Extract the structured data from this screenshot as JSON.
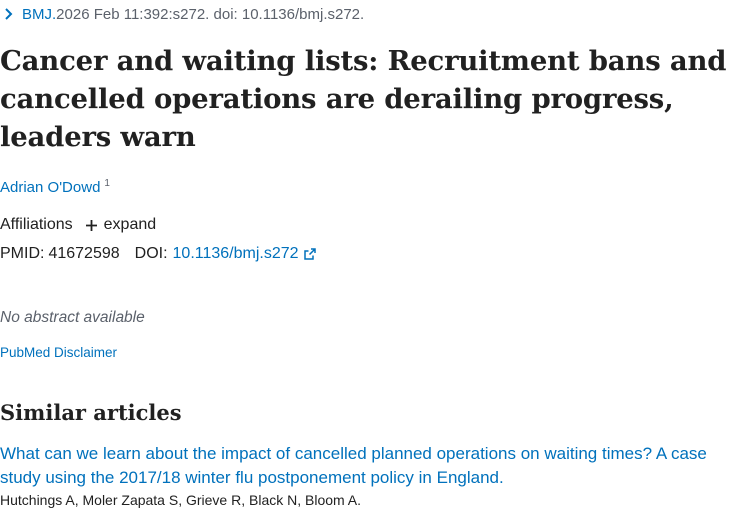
{
  "citation": {
    "journal": "BMJ.",
    "details": " 2026 Feb 11:392:s272. doi: 10.1136/bmj.s272."
  },
  "article": {
    "title": "Cancer and waiting lists: Recruitment bans and cancelled operations are derailing progress, leaders warn",
    "author": "Adrian O'Dowd",
    "author_affiliation_number": "1",
    "affiliations_label": "Affiliations",
    "expand_label": "expand",
    "pmid_label": "PMID:",
    "pmid": "41672598",
    "doi_label": "DOI:",
    "doi": "10.1136/bmj.s272"
  },
  "abstract_note": "No abstract available",
  "disclaimer_link": "PubMed Disclaimer",
  "similar": {
    "heading": "Similar articles",
    "first_title": "What can we learn about the impact of cancelled planned operations on waiting times? A case study using the 2017/18 winter flu postponement policy in England.",
    "first_authors": "Hutchings A, Moler Zapata S, Grieve R, Black N, Bloom A."
  },
  "icons": {
    "citation_toggle": "chevron-right-icon",
    "expand": "plus-icon",
    "doi_link": "external-link-icon"
  },
  "colors": {
    "link": "#0071bc",
    "text": "#212121",
    "muted": "#5b616b"
  }
}
